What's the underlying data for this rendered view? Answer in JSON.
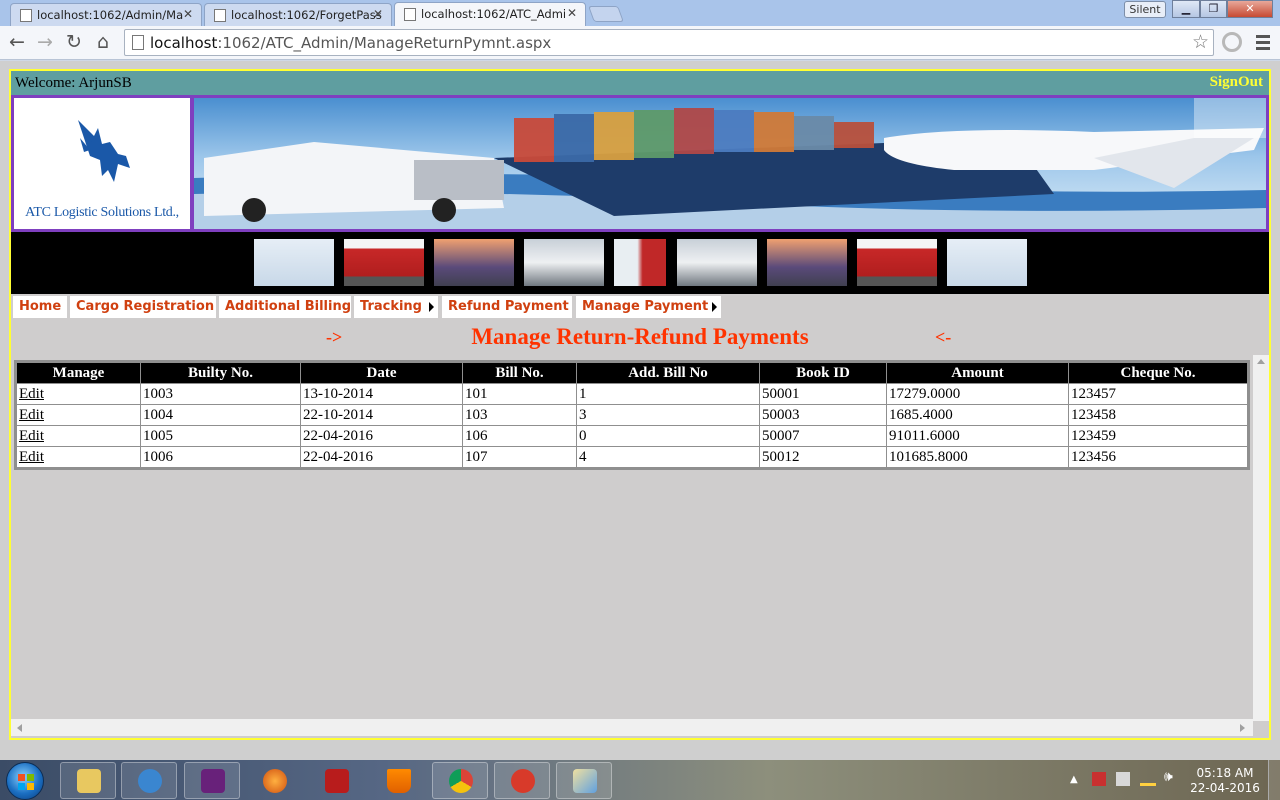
{
  "browser": {
    "tabs": [
      {
        "title": "localhost:1062/Admin/Ma"
      },
      {
        "title": "localhost:1062/ForgetPass"
      },
      {
        "title": "localhost:1062/ATC_Admi"
      }
    ],
    "silent_label": "Silent",
    "url_host": "localhost",
    "url_rest": ":1062/ATC_Admin/ManageReturnPymnt.aspx"
  },
  "header": {
    "welcome": "Welcome: ArjunSB",
    "signout": "SignOut",
    "logo_text": "ATC Logistic Solutions Ltd.,"
  },
  "menu": [
    {
      "label": "Home"
    },
    {
      "label": "Cargo Registration"
    },
    {
      "label": "Additional Billing"
    },
    {
      "label": "Tracking"
    },
    {
      "label": "Refund Payment"
    },
    {
      "label": "Manage Payment"
    }
  ],
  "page": {
    "title": "Manage Return-Refund Payments",
    "deco_left": "->",
    "deco_right": "<-"
  },
  "grid": {
    "columns": [
      "Manage",
      "Builty No.",
      "Date",
      "Bill No.",
      "Add. Bill No",
      "Book ID",
      "Amount",
      "Cheque No."
    ],
    "rows": [
      [
        "Edit",
        "1003",
        "13-10-2014",
        "101",
        "1",
        "50001",
        "17279.0000",
        "123457"
      ],
      [
        "Edit",
        "1004",
        "22-10-2014",
        "103",
        "3",
        "50003",
        "1685.4000",
        "123458"
      ],
      [
        "Edit",
        "1005",
        "22-04-2016",
        "106",
        "0",
        "50007",
        "91011.6000",
        "123459"
      ],
      [
        "Edit",
        "1006",
        "22-04-2016",
        "107",
        "4",
        "50012",
        "101685.8000",
        "123456"
      ]
    ]
  },
  "taskbar": {
    "time": "05:18 AM",
    "date": "22-04-2016"
  }
}
